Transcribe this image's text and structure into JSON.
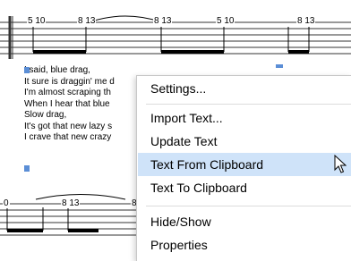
{
  "tab_labels": {
    "top": [
      {
        "id": "t1",
        "text": "5 10"
      },
      {
        "id": "t2",
        "text": "8 13"
      },
      {
        "id": "t3",
        "text": "8 13"
      },
      {
        "id": "t4",
        "text": "5 10"
      },
      {
        "id": "t5",
        "text": "8 13"
      }
    ],
    "bottom": [
      {
        "id": "b1",
        "text": "0"
      },
      {
        "id": "b2",
        "text": "8 13"
      },
      {
        "id": "b3",
        "text": "8"
      }
    ]
  },
  "lyrics": [
    "I said, blue drag,",
    "It sure is draggin' me d",
    "I'm almost scraping th",
    "When I hear that blue",
    "Slow drag,",
    "It's got that new lazy s",
    "I crave that new crazy"
  ],
  "context_menu": {
    "items": [
      {
        "label": "Settings...",
        "highlighted": false
      },
      {
        "label": "Import Text...",
        "highlighted": false
      },
      {
        "label": "Update Text",
        "highlighted": false
      },
      {
        "label": "Text From Clipboard",
        "highlighted": true
      },
      {
        "label": "Text To Clipboard",
        "highlighted": false
      },
      {
        "label": "Hide/Show",
        "highlighted": false
      },
      {
        "label": "Properties",
        "highlighted": false
      }
    ]
  },
  "colors": {
    "highlight": "#cfe3f9",
    "handle": "#5b8ed6"
  }
}
